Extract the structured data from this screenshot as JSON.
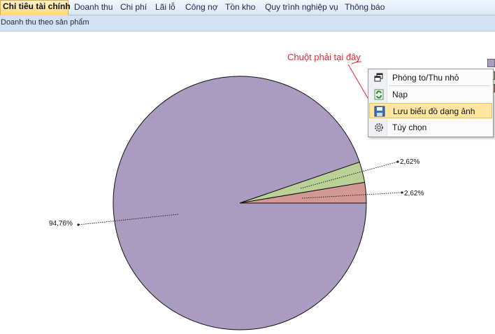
{
  "menu_tabs": [
    {
      "label": "Chỉ tiêu tài chính",
      "active": true
    },
    {
      "label": "Doanh thu"
    },
    {
      "label": "Chi phí"
    },
    {
      "label": "Lãi lỗ"
    },
    {
      "label": "Công nợ"
    },
    {
      "label": "Tồn kho"
    },
    {
      "label": "Quy trình nghiệp vụ"
    },
    {
      "label": "Thông báo"
    }
  ],
  "subbar": {
    "title": "Doanh thu theo sản phẩm"
  },
  "annotation": {
    "text": "Chuột phải tại đây",
    "color": "#e8262b"
  },
  "context_menu": {
    "items": [
      {
        "label": "Phóng to/Thu nhỏ",
        "icon": "restore-window-icon"
      },
      {
        "label": "Nạp",
        "icon": "refresh-icon"
      },
      {
        "label": "Lưu biểu đồ dạng ảnh",
        "icon": "save-disk-icon",
        "highlighted": true
      },
      {
        "label": "Tùy chọn",
        "icon": "gear-icon"
      }
    ]
  },
  "chart_data": {
    "type": "pie",
    "values": [
      94.76,
      2.62,
      2.62
    ],
    "data_labels": [
      "94,76%",
      "2,62%",
      "2,62%"
    ],
    "colors": [
      "#a99cc0",
      "#b9d096",
      "#d29893"
    ],
    "legend": "top-right"
  }
}
